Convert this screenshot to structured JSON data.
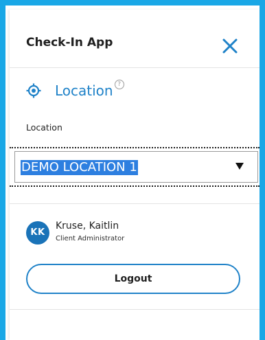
{
  "header": {
    "title": "Check-In App",
    "close_icon": "close-icon"
  },
  "location_section": {
    "heading": "Location",
    "help_icon_glyph": "?",
    "heading_icon": "target-icon"
  },
  "location_field": {
    "label": "Location",
    "selected_value": "DEMO LOCATION 1",
    "arrow_icon": "dropdown-arrow-icon"
  },
  "user": {
    "initials": "KK",
    "name": "Kruse, Kaitlin",
    "role": "Client Administrator"
  },
  "actions": {
    "logout_label": "Logout"
  },
  "colors": {
    "frame_border": "#19a7e6",
    "accent_blue": "#1f82c8",
    "avatar_bg": "#1a73b8",
    "selection_highlight": "#2d7fe0"
  }
}
